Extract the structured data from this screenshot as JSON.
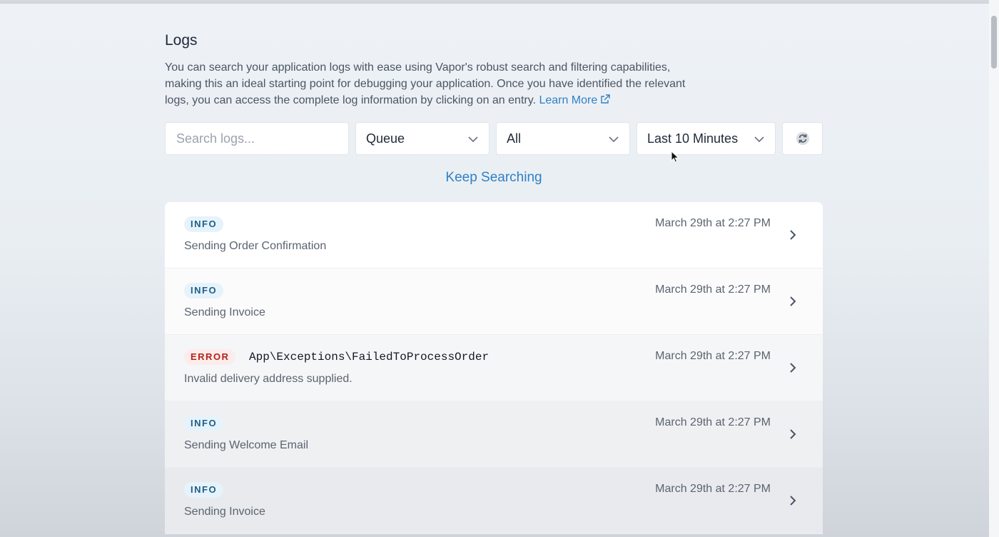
{
  "page": {
    "title": "Logs",
    "description": "You can search your application logs with ease using Vapor's robust search and filtering capabilities, making this an ideal starting point for debugging your application. Once you have identified the relevant logs, you can access the complete log information by clicking on an entry.",
    "learn_more_label": "Learn More",
    "learn_more_icon": "external-link-icon"
  },
  "filters": {
    "search_placeholder": "Search logs...",
    "search_value": "",
    "source_select": "Queue",
    "level_select": "All",
    "range_select": "Last 10 Minutes",
    "refresh_icon": "refresh-icon"
  },
  "keep_searching_label": "Keep Searching",
  "colors": {
    "accent": "#2f80c3",
    "info_badge_bg": "#e6f3fb",
    "info_badge_text": "#1f5f86",
    "error_badge_bg": "#fdecec",
    "error_badge_text": "#b42318"
  },
  "logs": [
    {
      "level": "INFO",
      "exception": "",
      "message": "Sending Order Confirmation",
      "timestamp": "March 29th at 2:27 PM"
    },
    {
      "level": "INFO",
      "exception": "",
      "message": "Sending Invoice",
      "timestamp": "March 29th at 2:27 PM"
    },
    {
      "level": "ERROR",
      "exception": "App\\Exceptions\\FailedToProcessOrder",
      "message": "Invalid delivery address supplied.",
      "timestamp": "March 29th at 2:27 PM"
    },
    {
      "level": "INFO",
      "exception": "",
      "message": "Sending Welcome Email",
      "timestamp": "March 29th at 2:27 PM"
    },
    {
      "level": "INFO",
      "exception": "",
      "message": "Sending Invoice",
      "timestamp": "March 29th at 2:27 PM"
    }
  ]
}
